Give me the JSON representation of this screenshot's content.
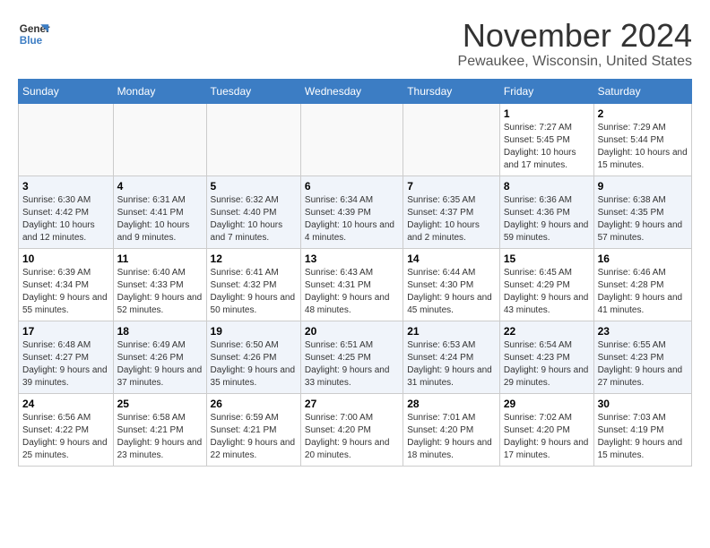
{
  "logo": {
    "line1": "General",
    "line2": "Blue"
  },
  "title": "November 2024",
  "subtitle": "Pewaukee, Wisconsin, United States",
  "days_of_week": [
    "Sunday",
    "Monday",
    "Tuesday",
    "Wednesday",
    "Thursday",
    "Friday",
    "Saturday"
  ],
  "weeks": [
    [
      {
        "day": "",
        "sunrise": "",
        "sunset": "",
        "daylight": ""
      },
      {
        "day": "",
        "sunrise": "",
        "sunset": "",
        "daylight": ""
      },
      {
        "day": "",
        "sunrise": "",
        "sunset": "",
        "daylight": ""
      },
      {
        "day": "",
        "sunrise": "",
        "sunset": "",
        "daylight": ""
      },
      {
        "day": "",
        "sunrise": "",
        "sunset": "",
        "daylight": ""
      },
      {
        "day": "1",
        "sunrise": "Sunrise: 7:27 AM",
        "sunset": "Sunset: 5:45 PM",
        "daylight": "Daylight: 10 hours and 17 minutes."
      },
      {
        "day": "2",
        "sunrise": "Sunrise: 7:29 AM",
        "sunset": "Sunset: 5:44 PM",
        "daylight": "Daylight: 10 hours and 15 minutes."
      }
    ],
    [
      {
        "day": "3",
        "sunrise": "Sunrise: 6:30 AM",
        "sunset": "Sunset: 4:42 PM",
        "daylight": "Daylight: 10 hours and 12 minutes."
      },
      {
        "day": "4",
        "sunrise": "Sunrise: 6:31 AM",
        "sunset": "Sunset: 4:41 PM",
        "daylight": "Daylight: 10 hours and 9 minutes."
      },
      {
        "day": "5",
        "sunrise": "Sunrise: 6:32 AM",
        "sunset": "Sunset: 4:40 PM",
        "daylight": "Daylight: 10 hours and 7 minutes."
      },
      {
        "day": "6",
        "sunrise": "Sunrise: 6:34 AM",
        "sunset": "Sunset: 4:39 PM",
        "daylight": "Daylight: 10 hours and 4 minutes."
      },
      {
        "day": "7",
        "sunrise": "Sunrise: 6:35 AM",
        "sunset": "Sunset: 4:37 PM",
        "daylight": "Daylight: 10 hours and 2 minutes."
      },
      {
        "day": "8",
        "sunrise": "Sunrise: 6:36 AM",
        "sunset": "Sunset: 4:36 PM",
        "daylight": "Daylight: 9 hours and 59 minutes."
      },
      {
        "day": "9",
        "sunrise": "Sunrise: 6:38 AM",
        "sunset": "Sunset: 4:35 PM",
        "daylight": "Daylight: 9 hours and 57 minutes."
      }
    ],
    [
      {
        "day": "10",
        "sunrise": "Sunrise: 6:39 AM",
        "sunset": "Sunset: 4:34 PM",
        "daylight": "Daylight: 9 hours and 55 minutes."
      },
      {
        "day": "11",
        "sunrise": "Sunrise: 6:40 AM",
        "sunset": "Sunset: 4:33 PM",
        "daylight": "Daylight: 9 hours and 52 minutes."
      },
      {
        "day": "12",
        "sunrise": "Sunrise: 6:41 AM",
        "sunset": "Sunset: 4:32 PM",
        "daylight": "Daylight: 9 hours and 50 minutes."
      },
      {
        "day": "13",
        "sunrise": "Sunrise: 6:43 AM",
        "sunset": "Sunset: 4:31 PM",
        "daylight": "Daylight: 9 hours and 48 minutes."
      },
      {
        "day": "14",
        "sunrise": "Sunrise: 6:44 AM",
        "sunset": "Sunset: 4:30 PM",
        "daylight": "Daylight: 9 hours and 45 minutes."
      },
      {
        "day": "15",
        "sunrise": "Sunrise: 6:45 AM",
        "sunset": "Sunset: 4:29 PM",
        "daylight": "Daylight: 9 hours and 43 minutes."
      },
      {
        "day": "16",
        "sunrise": "Sunrise: 6:46 AM",
        "sunset": "Sunset: 4:28 PM",
        "daylight": "Daylight: 9 hours and 41 minutes."
      }
    ],
    [
      {
        "day": "17",
        "sunrise": "Sunrise: 6:48 AM",
        "sunset": "Sunset: 4:27 PM",
        "daylight": "Daylight: 9 hours and 39 minutes."
      },
      {
        "day": "18",
        "sunrise": "Sunrise: 6:49 AM",
        "sunset": "Sunset: 4:26 PM",
        "daylight": "Daylight: 9 hours and 37 minutes."
      },
      {
        "day": "19",
        "sunrise": "Sunrise: 6:50 AM",
        "sunset": "Sunset: 4:26 PM",
        "daylight": "Daylight: 9 hours and 35 minutes."
      },
      {
        "day": "20",
        "sunrise": "Sunrise: 6:51 AM",
        "sunset": "Sunset: 4:25 PM",
        "daylight": "Daylight: 9 hours and 33 minutes."
      },
      {
        "day": "21",
        "sunrise": "Sunrise: 6:53 AM",
        "sunset": "Sunset: 4:24 PM",
        "daylight": "Daylight: 9 hours and 31 minutes."
      },
      {
        "day": "22",
        "sunrise": "Sunrise: 6:54 AM",
        "sunset": "Sunset: 4:23 PM",
        "daylight": "Daylight: 9 hours and 29 minutes."
      },
      {
        "day": "23",
        "sunrise": "Sunrise: 6:55 AM",
        "sunset": "Sunset: 4:23 PM",
        "daylight": "Daylight: 9 hours and 27 minutes."
      }
    ],
    [
      {
        "day": "24",
        "sunrise": "Sunrise: 6:56 AM",
        "sunset": "Sunset: 4:22 PM",
        "daylight": "Daylight: 9 hours and 25 minutes."
      },
      {
        "day": "25",
        "sunrise": "Sunrise: 6:58 AM",
        "sunset": "Sunset: 4:21 PM",
        "daylight": "Daylight: 9 hours and 23 minutes."
      },
      {
        "day": "26",
        "sunrise": "Sunrise: 6:59 AM",
        "sunset": "Sunset: 4:21 PM",
        "daylight": "Daylight: 9 hours and 22 minutes."
      },
      {
        "day": "27",
        "sunrise": "Sunrise: 7:00 AM",
        "sunset": "Sunset: 4:20 PM",
        "daylight": "Daylight: 9 hours and 20 minutes."
      },
      {
        "day": "28",
        "sunrise": "Sunrise: 7:01 AM",
        "sunset": "Sunset: 4:20 PM",
        "daylight": "Daylight: 9 hours and 18 minutes."
      },
      {
        "day": "29",
        "sunrise": "Sunrise: 7:02 AM",
        "sunset": "Sunset: 4:20 PM",
        "daylight": "Daylight: 9 hours and 17 minutes."
      },
      {
        "day": "30",
        "sunrise": "Sunrise: 7:03 AM",
        "sunset": "Sunset: 4:19 PM",
        "daylight": "Daylight: 9 hours and 15 minutes."
      }
    ]
  ]
}
